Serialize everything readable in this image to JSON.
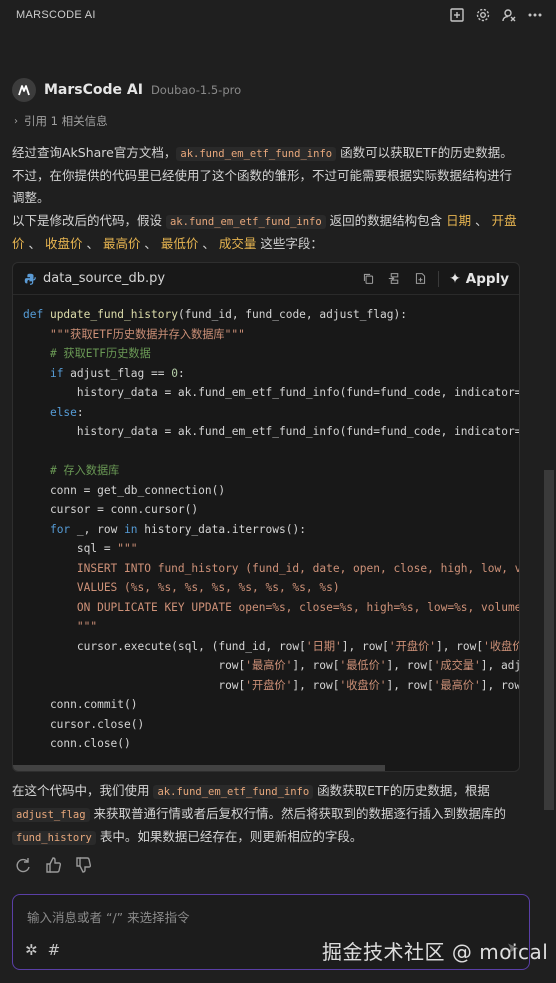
{
  "topbar": {
    "title": "MARSCODE AI",
    "icons": [
      "new-chat-icon",
      "settings-icon",
      "feedback-icon",
      "more-icon"
    ]
  },
  "message": {
    "agent_name": "MarsCode AI",
    "model_name": "Doubao-1.5-pro",
    "reference": "引用 1 相关信息"
  },
  "para1": {
    "t1": "经过查询AkShare官方文档，",
    "code1": "ak.fund_em_etf_fund_info",
    "t2": " 函数可以获取ETF的历史数据。不过，在你提供的代码里已经使用了这个函数的雏形，不过可能需要根据实际数据结构进行调整。"
  },
  "para2": {
    "t1": "以下是修改后的代码，假设 ",
    "code1": "ak.fund_em_etf_fund_info",
    "t2": " 返回的数据结构包含 ",
    "f1": "日期",
    "sep": " 、 ",
    "f2": "开盘价",
    "f3": "收盘价",
    "f4": "最高价",
    "f5": "最低价",
    "f6": "成交量",
    "t3": " 这些字段："
  },
  "codeblock": {
    "filename": "data_source_db.py",
    "apply_label": "Apply",
    "lines": [
      {
        "parts": [
          [
            "kw",
            "def "
          ],
          [
            "fn",
            "update_fund_history"
          ],
          [
            "",
            "(fund_id, fund_code, adjust_flag):"
          ]
        ]
      },
      {
        "parts": [
          [
            "",
            "    "
          ],
          [
            "str",
            "\"\"\"获取ETF历史数据并存入数据库\"\"\""
          ]
        ]
      },
      {
        "parts": [
          [
            "",
            "    "
          ],
          [
            "cm",
            "# 获取ETF历史数据"
          ]
        ]
      },
      {
        "parts": [
          [
            "",
            "    "
          ],
          [
            "kw",
            "if"
          ],
          [
            "",
            " adjust_flag == "
          ],
          [
            "num",
            "0"
          ],
          [
            "",
            ":"
          ]
        ]
      },
      {
        "parts": [
          [
            "",
            "        history_data = ak.fund_em_etf_fund_info(fund=fund_code, indicator=\""
          ]
        ]
      },
      {
        "parts": [
          [
            "",
            "    "
          ],
          [
            "kw",
            "else"
          ],
          [
            "",
            ":"
          ]
        ]
      },
      {
        "parts": [
          [
            "",
            "        history_data = ak.fund_em_etf_fund_info(fund=fund_code, indicator=\""
          ]
        ]
      },
      {
        "parts": [
          [
            "",
            ""
          ]
        ]
      },
      {
        "parts": [
          [
            "",
            "    "
          ],
          [
            "cm",
            "# 存入数据库"
          ]
        ]
      },
      {
        "parts": [
          [
            "",
            "    conn = get_db_connection()"
          ]
        ]
      },
      {
        "parts": [
          [
            "",
            "    cursor = conn.cursor()"
          ]
        ]
      },
      {
        "parts": [
          [
            "",
            "    "
          ],
          [
            "kw",
            "for"
          ],
          [
            "",
            " _, row "
          ],
          [
            "kw",
            "in"
          ],
          [
            "",
            " history_data.iterrows():"
          ]
        ]
      },
      {
        "parts": [
          [
            "",
            "        sql = "
          ],
          [
            "str",
            "\"\"\""
          ]
        ]
      },
      {
        "parts": [
          [
            "str",
            "        INSERT INTO fund_history (fund_id, date, open, close, high, low, vo"
          ]
        ]
      },
      {
        "parts": [
          [
            "str",
            "        VALUES (%s, %s, %s, %s, %s, %s, %s, %s)"
          ]
        ]
      },
      {
        "parts": [
          [
            "str",
            "        ON DUPLICATE KEY UPDATE open=%s, close=%s, high=%s, low=%s, volume="
          ]
        ]
      },
      {
        "parts": [
          [
            "str",
            "        \"\"\""
          ]
        ]
      },
      {
        "parts": [
          [
            "",
            "        cursor.execute(sql, (fund_id, row["
          ],
          [
            "str",
            "'日期'"
          ],
          [
            "",
            "], row["
          ],
          [
            "str",
            "'开盘价'"
          ],
          [
            "",
            "], row["
          ],
          [
            "str",
            "'收盘价"
          ]
        ]
      },
      {
        "parts": [
          [
            "",
            "                             row["
          ],
          [
            "str",
            "'最高价'"
          ],
          [
            "",
            "], row["
          ],
          [
            "str",
            "'最低价'"
          ],
          [
            "",
            "], row["
          ],
          [
            "str",
            "'成交量'"
          ],
          [
            "",
            "], adj"
          ]
        ]
      },
      {
        "parts": [
          [
            "",
            "                             row["
          ],
          [
            "str",
            "'开盘价'"
          ],
          [
            "",
            "], row["
          ],
          [
            "str",
            "'收盘价'"
          ],
          [
            "",
            "], row["
          ],
          [
            "str",
            "'最高价'"
          ],
          [
            "",
            "], row"
          ]
        ]
      },
      {
        "parts": [
          [
            "",
            "    conn.commit()"
          ]
        ]
      },
      {
        "parts": [
          [
            "",
            "    cursor.close()"
          ]
        ]
      },
      {
        "parts": [
          [
            "",
            "    conn.close()"
          ]
        ]
      }
    ]
  },
  "para3": {
    "t1": "在这个代码中，我们使用 ",
    "code1": "ak.fund_em_etf_fund_info",
    "t2": " 函数获取ETF的历史数据，根据 ",
    "code2": "adjust_flag",
    "t3": " 来获取普通行情或者后复权行情。然后将获取到的数据逐行插入到数据库的 ",
    "code3": "fund_history",
    "t4": " 表中。如果数据已经存在，则更新相应的字段。"
  },
  "input": {
    "placeholder": "输入消息或者 “/” 来选择指令"
  },
  "watermark": "掘金技术社区 @ moical"
}
